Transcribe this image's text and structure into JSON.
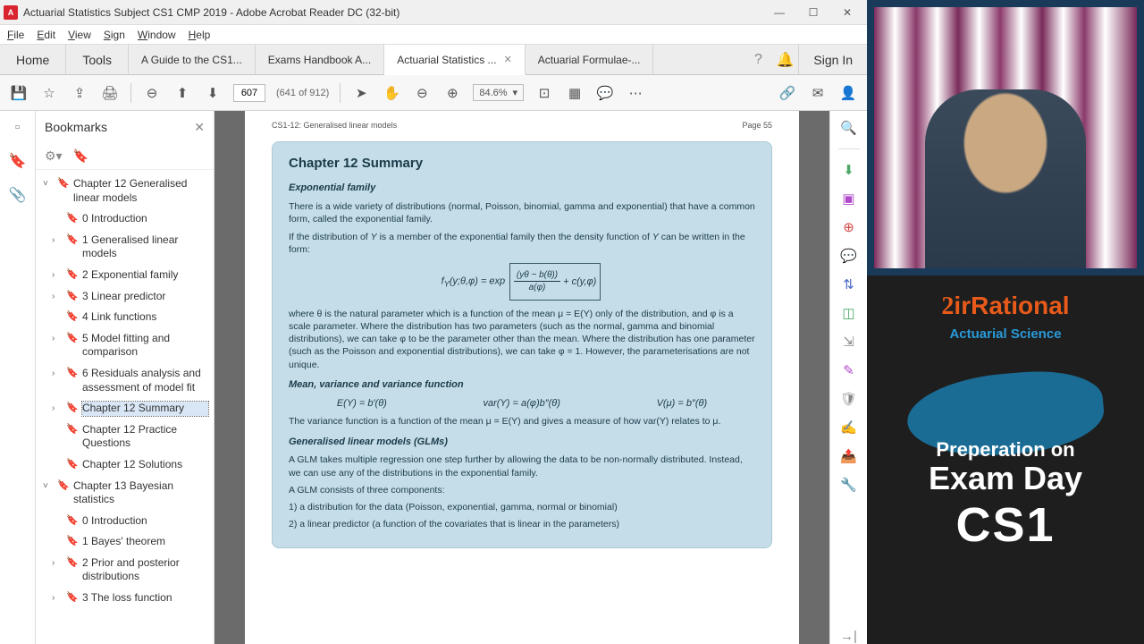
{
  "window": {
    "title": "Actuarial Statistics Subject CS1 CMP 2019 - Adobe Acrobat Reader DC (32-bit)"
  },
  "menu": {
    "file": "File",
    "edit": "Edit",
    "view": "View",
    "sign": "Sign",
    "window": "Window",
    "help": "Help"
  },
  "tabs": {
    "home": "Home",
    "tools": "Tools",
    "t1": "A Guide to the CS1...",
    "t2": "Exams Handbook A...",
    "t3": "Actuarial Statistics ...",
    "t4": "Actuarial Formulae-...",
    "signin": "Sign In"
  },
  "toolbar": {
    "page": "607",
    "total": "(641 of 912)",
    "zoom": "84.6%"
  },
  "bookmarks": {
    "title": "Bookmarks",
    "items": [
      {
        "cv": "˅",
        "ind": 0,
        "label": "Chapter 12 Generalised linear models"
      },
      {
        "cv": "",
        "ind": 1,
        "label": "0 Introduction"
      },
      {
        "cv": "›",
        "ind": 1,
        "label": "1 Generalised linear models"
      },
      {
        "cv": "›",
        "ind": 1,
        "label": "2 Exponential family"
      },
      {
        "cv": "›",
        "ind": 1,
        "label": "3 Linear predictor"
      },
      {
        "cv": "",
        "ind": 1,
        "label": "4 Link functions"
      },
      {
        "cv": "›",
        "ind": 1,
        "label": "5 Model fitting and comparison"
      },
      {
        "cv": "›",
        "ind": 1,
        "label": "6 Residuals analysis and assessment of model fit"
      },
      {
        "cv": "›",
        "ind": 1,
        "label": "Chapter 12 Summary",
        "sel": true
      },
      {
        "cv": "",
        "ind": 1,
        "label": "Chapter 12 Practice Questions"
      },
      {
        "cv": "",
        "ind": 1,
        "label": "Chapter 12 Solutions"
      },
      {
        "cv": "˅",
        "ind": 0,
        "label": "Chapter 13 Bayesian statistics"
      },
      {
        "cv": "",
        "ind": 1,
        "label": "0 Introduction"
      },
      {
        "cv": "",
        "ind": 1,
        "label": "1 Bayes' theorem"
      },
      {
        "cv": "›",
        "ind": 1,
        "label": "2 Prior and posterior distributions"
      },
      {
        "cv": "›",
        "ind": 1,
        "label": "3 The loss function"
      }
    ]
  },
  "page": {
    "header_left": "CS1-12: Generalised linear models",
    "header_right": "Page 55",
    "h2": "Chapter 12 Summary",
    "s1_h": "Exponential family",
    "s1_p1": "There is a wide variety of distributions (normal, Poisson, binomial, gamma and exponential) that have a common form, called the exponential family.",
    "s1_p2a": "If the distribution of ",
    "s1_p2y": "Y",
    "s1_p2b": " is a member of the exponential family then the density function of ",
    "s1_p2c": " can be written in the form:",
    "f1_l": "f",
    "f1_sub": "Y",
    "f1_arg": "(y;θ,φ) = exp",
    "f1_num": "(yθ − b(θ))",
    "f1_den": "a(φ)",
    "f1_tail": "+ c(y,φ)",
    "s1_p3": "where θ is the natural parameter which is a function of the mean μ = E(Y) only of the distribution, and φ is a scale parameter.  Where the distribution has two parameters (such as the normal, gamma and binomial distributions), we can take φ to be the parameter other than the mean.  Where the distribution has one parameter (such as the Poisson and exponential distributions), we can take φ = 1.  However, the parameterisations are not unique.",
    "s2_h": "Mean, variance and variance function",
    "s2_f1": "E(Y) = b′(θ)",
    "s2_f2": "var(Y) = a(φ)b″(θ)",
    "s2_f3": "V(μ) = b″(θ)",
    "s2_p1": "The variance function is a function of the mean μ = E(Y) and gives a measure of how var(Y) relates to μ.",
    "s3_h": "Generalised linear models (GLMs)",
    "s3_p1": "A GLM takes multiple regression one step further by allowing the data to be non-normally distributed.  Instead, we can use any of the distributions in the exponential family.",
    "s3_p2": "A GLM consists of three components:",
    "s3_li1": "1)        a distribution for the data (Poisson, exponential, gamma, normal or binomial)",
    "s3_li2": "2)        a linear predictor (a function of the covariates that is linear in the parameters)"
  },
  "overlay": {
    "brand_2": "2",
    "brand_ir": "irRational",
    "brand_sub": "Actuarial Science",
    "l1": "Preperation on",
    "l2": "Exam Day",
    "l3": "CS1"
  }
}
